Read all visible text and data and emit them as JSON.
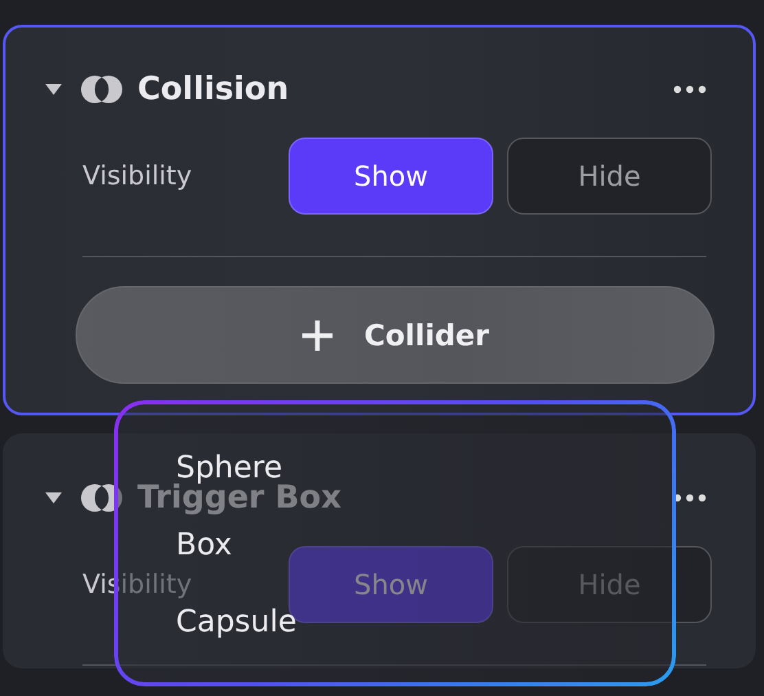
{
  "panels": [
    {
      "title": "Collision",
      "expanded": true,
      "focused": true,
      "visibility_label": "Visibility",
      "options": [
        {
          "label": "Show",
          "selected": true
        },
        {
          "label": "Hide",
          "selected": false
        }
      ],
      "add_button": "Collider"
    },
    {
      "title": "Trigger Box",
      "expanded": true,
      "focused": false,
      "visibility_label": "Visibility",
      "options": [
        {
          "label": "Show",
          "selected": true
        },
        {
          "label": "Hide",
          "selected": false
        }
      ]
    }
  ],
  "menu": {
    "items": [
      "Sphere",
      "Box",
      "Capsule"
    ]
  }
}
